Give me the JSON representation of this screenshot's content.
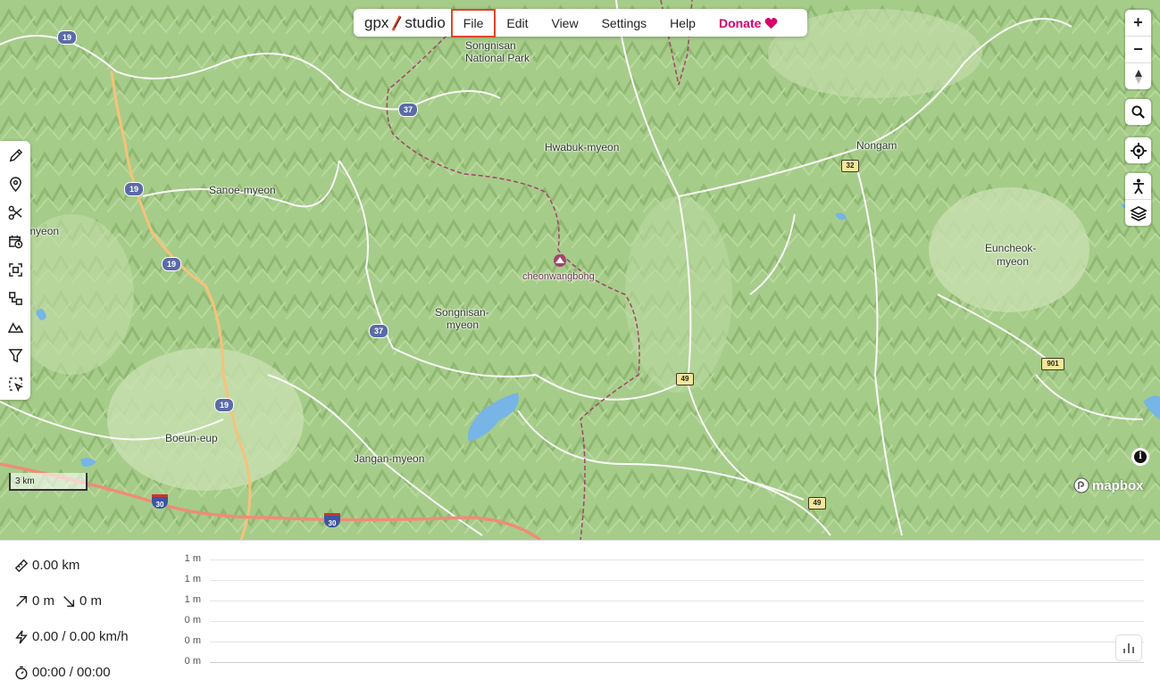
{
  "app": {
    "logo_left": "gpx",
    "logo_right": "studio"
  },
  "menu": {
    "items": [
      "File",
      "Edit",
      "View",
      "Settings",
      "Help"
    ],
    "active": "File",
    "donate_label": "Donate",
    "donate_color": "#d6006e"
  },
  "map": {
    "places": [
      {
        "label": "Songnisan",
        "id": "songnisan-np-1"
      },
      {
        "label": "National Park",
        "id": "songnisan-np-2"
      },
      {
        "label": "Hwabuk-myeon",
        "id": "hwabuk-myeon"
      },
      {
        "label": "Nongam",
        "id": "nongam"
      },
      {
        "label": "Sanoe-myeon",
        "id": "sanoe-myeon"
      },
      {
        "label": "ebuk-myeon",
        "id": "ebuk-myeon"
      },
      {
        "label": "cheonwangbong",
        "id": "cheonwangbong"
      },
      {
        "label": "Euncheok-",
        "id": "euncheok-1"
      },
      {
        "label": "myeon",
        "id": "euncheok-2"
      },
      {
        "label": "Songnisan-",
        "id": "songnisan-myeon-1"
      },
      {
        "label": "myeon",
        "id": "songnisan-myeon-2"
      },
      {
        "label": "Boeun-eup",
        "id": "boeun-eup"
      },
      {
        "label": "Jangan-myeon",
        "id": "jangan-myeon"
      }
    ],
    "routes": {
      "r19a": "19",
      "r19b": "19",
      "r19c": "19",
      "r19d": "19",
      "r37a": "37",
      "r37b": "37",
      "r32": "32",
      "r49a": "49",
      "r49b": "49",
      "r901": "901",
      "r33": "32",
      "i30a": "30",
      "i30b": "30"
    },
    "scale_label": "3 km",
    "attribution": "mapbox",
    "controls": {
      "zoom_in": "+",
      "zoom_out": "−"
    }
  },
  "stats": {
    "distance": "0.00 km",
    "elevation": "0 m",
    "descent": "0 m",
    "speed": "0.00 / 0.00 km/h",
    "time": "00:00 / 00:00"
  },
  "chart_data": {
    "type": "line",
    "ylabel": "",
    "yticks": [
      "1 m",
      "1 m",
      "1 m",
      "0 m",
      "0 m",
      "0 m"
    ],
    "series": []
  }
}
